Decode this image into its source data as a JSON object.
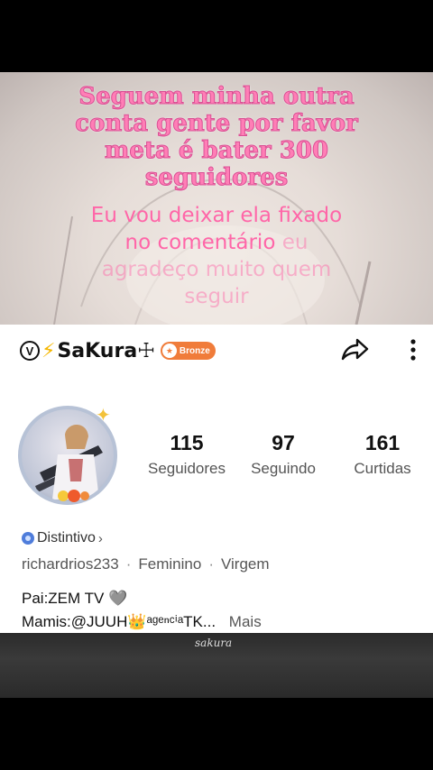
{
  "overlay": {
    "pink_title": "Seguem minha outra conta gente por favor meta é bater 300 seguidores",
    "pink_sub_a": "Eu vou deixar ela fixado no comentário",
    "pink_sub_b": "eu agradeço muito quem seguir"
  },
  "profile": {
    "verified_mark": "V",
    "bolt_glyph": "⚡",
    "username": "SaKura☩",
    "badge_label": "Bronze",
    "stats": [
      {
        "num": "115",
        "label": "Seguidores"
      },
      {
        "num": "97",
        "label": "Seguindo"
      },
      {
        "num": "161",
        "label": "Curtidas"
      }
    ],
    "distintivo": "Distintivo",
    "chevron": "›",
    "handle": "richardrios233",
    "gender": "Feminino",
    "sign": "Virgem",
    "bio_line1": "Pai:ZEM TV 🩶",
    "bio_line2": "Mamis:@JUUH👑ᵃᵍᵉⁿᶜⁱᵃTK...",
    "more_label": "Mais"
  },
  "signature": "sakura",
  "icons": {
    "share": "share-icon",
    "more": "more-vertical-icon"
  },
  "colors": {
    "pink_text": "#ff74b0",
    "badge": "#f07c3a"
  }
}
